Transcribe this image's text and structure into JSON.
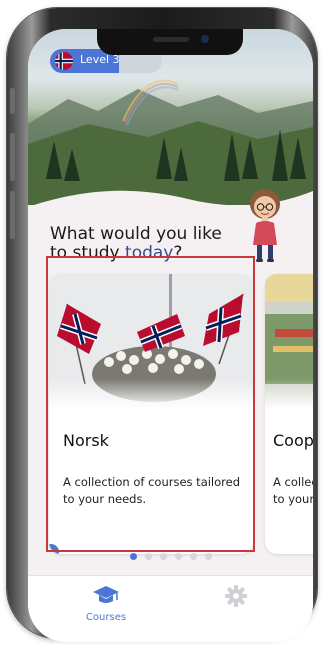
{
  "header": {
    "level_label": "Level 3",
    "level_progress": 0.62,
    "flag_icon": "norway-flag-icon"
  },
  "main": {
    "heading_prefix": "What would you like to study ",
    "heading_accent": "today",
    "heading_suffix": "?",
    "cards": [
      {
        "title": "Norsk",
        "description": "A collection of courses tailored to your needs."
      },
      {
        "title": "Coop",
        "description": "A collection of courses tailored to your needs."
      }
    ],
    "page_count": 6,
    "active_page": 0
  },
  "tabbar": {
    "items": [
      {
        "label": "Courses",
        "icon": "graduation-cap-icon",
        "active": true
      },
      {
        "label": "",
        "icon": "gear-icon",
        "active": false
      }
    ]
  },
  "colors": {
    "accent": "#4c76d6",
    "heading_accent": "#2e4c8f",
    "highlight": "#c9383d",
    "flag_red": "#ba0c2f",
    "flag_blue": "#00205b"
  }
}
